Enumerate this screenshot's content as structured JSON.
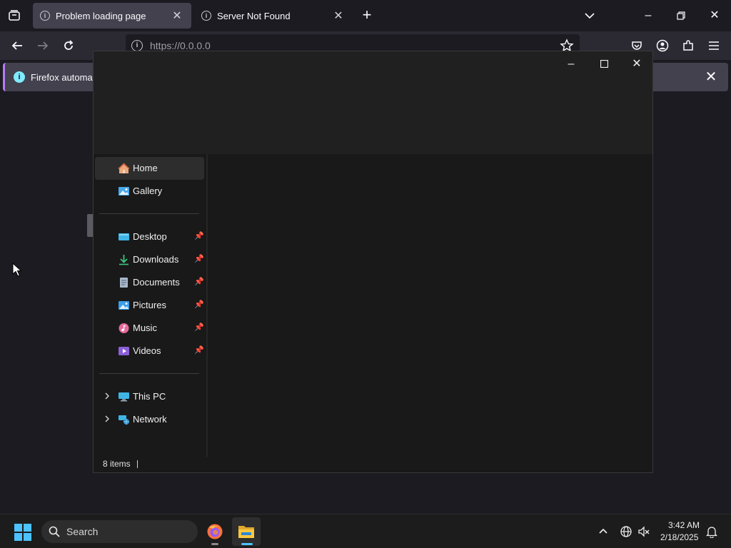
{
  "firefox": {
    "tabs": [
      {
        "title": "Problem loading page",
        "active": true
      },
      {
        "title": "Server Not Found",
        "active": false
      }
    ],
    "url": "https://0.0.0.0",
    "notification": {
      "text": "Firefox automatio"
    },
    "accent_color": "#b47cf5",
    "info_color": "#80ebff"
  },
  "explorer": {
    "nav": [
      {
        "label": "Home",
        "icon": "home-icon",
        "selected": true,
        "pinned": false
      },
      {
        "label": "Gallery",
        "icon": "gallery-icon",
        "selected": false,
        "pinned": false
      },
      {
        "label": "Desktop",
        "icon": "desktop-icon",
        "selected": false,
        "pinned": true
      },
      {
        "label": "Downloads",
        "icon": "downloads-icon",
        "selected": false,
        "pinned": true
      },
      {
        "label": "Documents",
        "icon": "documents-icon",
        "selected": false,
        "pinned": true
      },
      {
        "label": "Pictures",
        "icon": "pictures-icon",
        "selected": false,
        "pinned": true
      },
      {
        "label": "Music",
        "icon": "music-icon",
        "selected": false,
        "pinned": true
      },
      {
        "label": "Videos",
        "icon": "videos-icon",
        "selected": false,
        "pinned": true
      },
      {
        "label": "This PC",
        "icon": "this-pc-icon",
        "selected": false,
        "expandable": true
      },
      {
        "label": "Network",
        "icon": "network-icon",
        "selected": false,
        "expandable": true
      }
    ],
    "status": {
      "items": "8 items"
    }
  },
  "taskbar": {
    "search_placeholder": "Search",
    "time": "3:42 AM",
    "date": "2/18/2025",
    "accent_color": "#4cc2ff"
  }
}
